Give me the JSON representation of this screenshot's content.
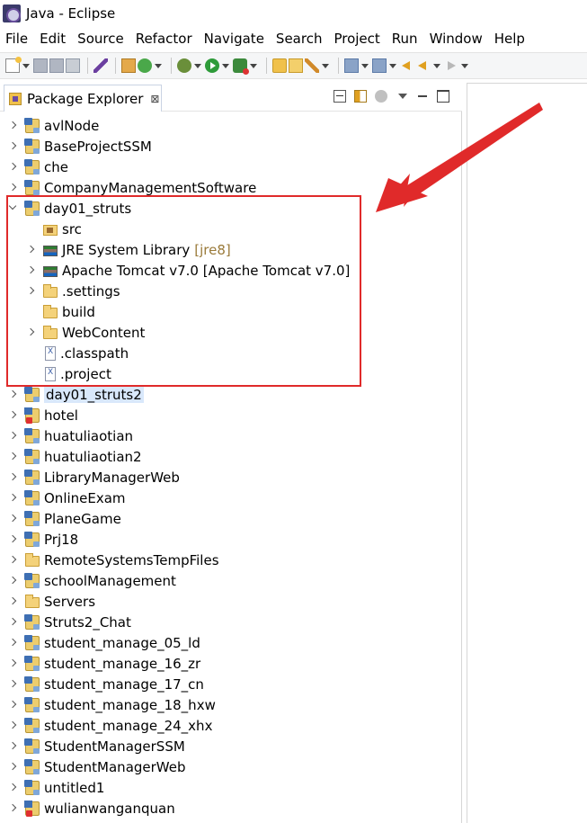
{
  "window": {
    "title": "Java - Eclipse"
  },
  "menubar": {
    "items": [
      "File",
      "Edit",
      "Source",
      "Refactor",
      "Navigate",
      "Search",
      "Project",
      "Run",
      "Window",
      "Help"
    ]
  },
  "view": {
    "title": "Package Explorer",
    "close_glyph": "⊠"
  },
  "tree": {
    "top_projects": [
      {
        "label": "avlNode",
        "icon": "project-icon"
      },
      {
        "label": "BaseProjectSSM",
        "icon": "project-icon"
      },
      {
        "label": "che",
        "icon": "project-icon"
      },
      {
        "label": "CompanyManagementSoftware",
        "icon": "project-icon"
      }
    ],
    "expanded_project": {
      "label": "day01_struts",
      "children": [
        {
          "label": "src",
          "icon": "source-folder-icon",
          "expandable": false
        },
        {
          "label": "JRE System Library",
          "suffix": "[jre8]",
          "icon": "library-icon",
          "expandable": true
        },
        {
          "label": "Apache Tomcat v7.0 [Apache Tomcat v7.0]",
          "suffix": "",
          "icon": "library-icon",
          "expandable": true
        },
        {
          "label": ".settings",
          "icon": "folder-icon",
          "expandable": true
        },
        {
          "label": "build",
          "icon": "folder-icon",
          "expandable": false
        },
        {
          "label": "WebContent",
          "icon": "folder-icon",
          "expandable": true
        },
        {
          "label": ".classpath",
          "icon": "xml-file-icon",
          "expandable": false
        },
        {
          "label": ".project",
          "icon": "xml-file-icon",
          "expandable": false
        }
      ]
    },
    "bottom_projects": [
      {
        "label": "day01_struts2",
        "icon": "project-icon",
        "selected": true
      },
      {
        "label": "hotel",
        "icon": "project-error-icon"
      },
      {
        "label": "huatuliaotian",
        "icon": "project-icon"
      },
      {
        "label": "huatuliaotian2",
        "icon": "project-icon"
      },
      {
        "label": "LibraryManagerWeb",
        "icon": "project-icon"
      },
      {
        "label": "OnlineExam",
        "icon": "project-icon"
      },
      {
        "label": "PlaneGame",
        "icon": "project-icon"
      },
      {
        "label": "Prj18",
        "icon": "project-icon"
      },
      {
        "label": "RemoteSystemsTempFiles",
        "icon": "folder-icon"
      },
      {
        "label": "schoolManagement",
        "icon": "project-icon"
      },
      {
        "label": "Servers",
        "icon": "folder-icon"
      },
      {
        "label": "Struts2_Chat",
        "icon": "project-icon"
      },
      {
        "label": "student_manage_05_ld",
        "icon": "project-icon"
      },
      {
        "label": "student_manage_16_zr",
        "icon": "project-icon"
      },
      {
        "label": "student_manage_17_cn",
        "icon": "project-icon"
      },
      {
        "label": "student_manage_18_hxw",
        "icon": "project-icon"
      },
      {
        "label": "student_manage_24_xhx",
        "icon": "project-icon"
      },
      {
        "label": "StudentManagerSSM",
        "icon": "project-icon"
      },
      {
        "label": "StudentManagerWeb",
        "icon": "project-icon"
      },
      {
        "label": "untitled1",
        "icon": "project-icon"
      },
      {
        "label": "wulianwanganquan",
        "icon": "project-error-icon"
      }
    ]
  },
  "colors": {
    "annotation": "#e02a2a",
    "selection": "#d9e8fb"
  }
}
